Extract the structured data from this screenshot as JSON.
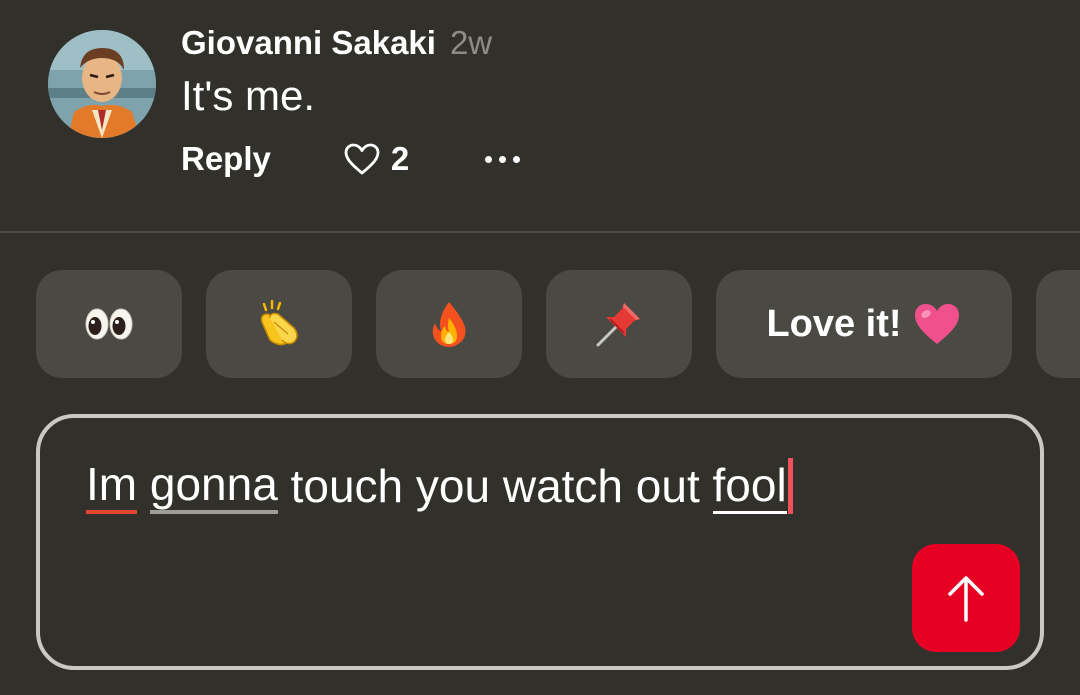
{
  "comment": {
    "author": "Giovanni Sakaki",
    "timestamp": "2w",
    "text": "It's me.",
    "reply_label": "Reply",
    "like_count": "2",
    "avatar_icon": "cartoon-man-in-suit-avatar",
    "like_icon": "heart-outline-icon",
    "more_icon": "ellipsis-icon"
  },
  "quick_reactions": [
    {
      "emoji": "👀",
      "icon": "eyes-emoji"
    },
    {
      "emoji": "👏",
      "icon": "clapping-hands-emoji"
    },
    {
      "emoji": "🔥",
      "icon": "fire-emoji"
    },
    {
      "emoji": "📌",
      "icon": "pushpin-emoji"
    },
    {
      "label": "Love it!",
      "emoji": "🩷",
      "icon": "pink-heart-emoji"
    }
  ],
  "composer": {
    "words": [
      "Im",
      "gonna",
      "touch you watch out",
      "fool"
    ],
    "send_icon": "arrow-up-icon"
  },
  "colors": {
    "background": "#31302b",
    "chip": "#4a4944",
    "accent": "#e60023",
    "muted_text": "#8d8c86",
    "composer_border": "#c9c8c3"
  }
}
